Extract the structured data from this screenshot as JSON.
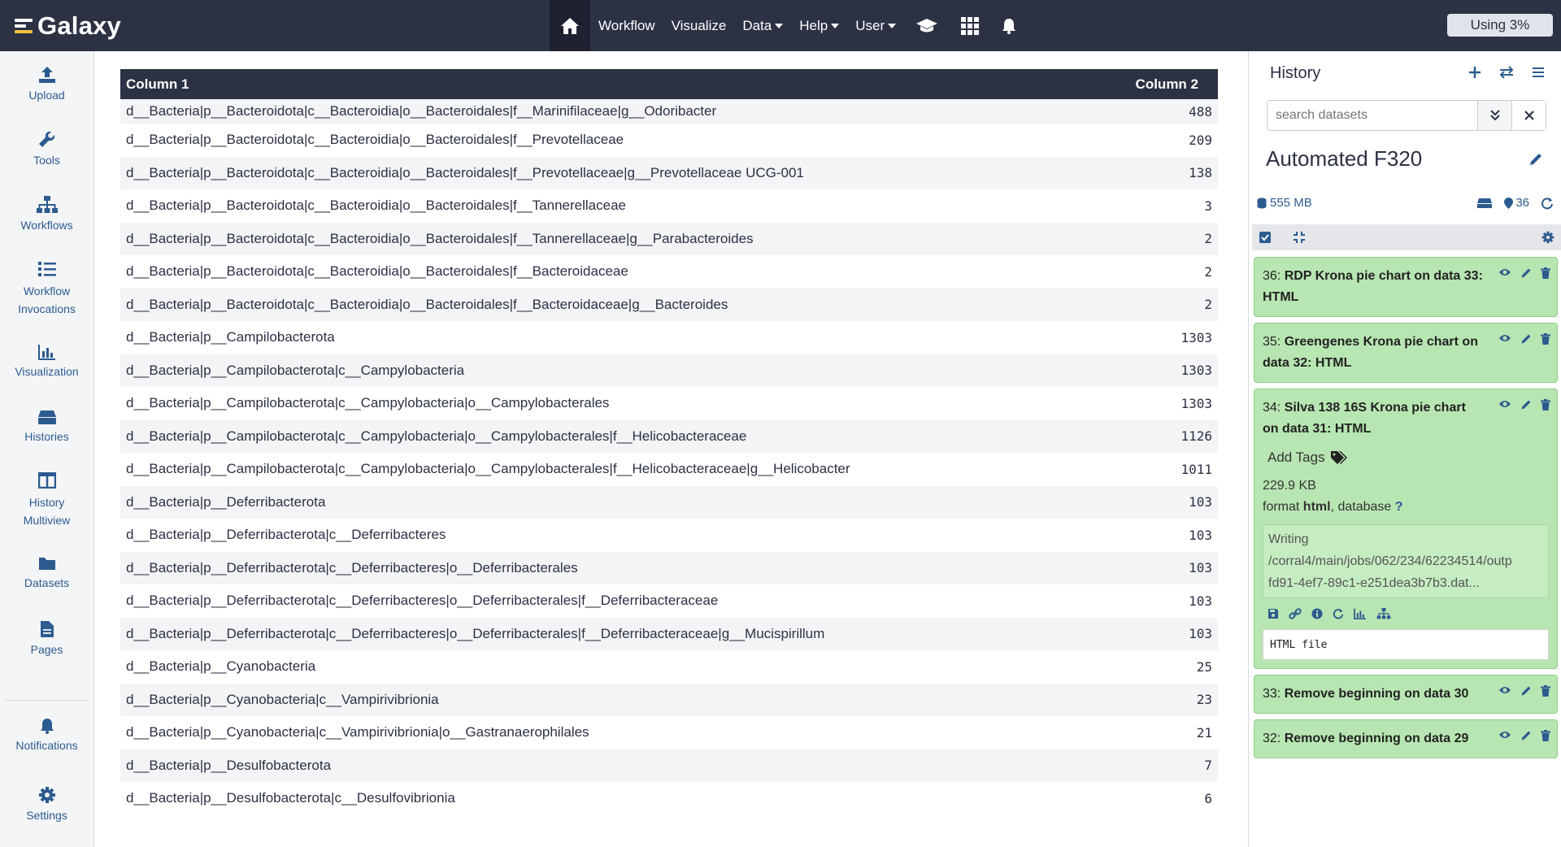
{
  "masthead": {
    "brand": "Galaxy",
    "nav": [
      "Workflow",
      "Visualize"
    ],
    "dropdowns": [
      "Data",
      "Help",
      "User"
    ],
    "quota": "Using 3%"
  },
  "activity": {
    "items": [
      {
        "label": "Upload",
        "icon": "upload-icon"
      },
      {
        "label": "Tools",
        "icon": "wrench-icon"
      },
      {
        "label": "Workflows",
        "icon": "sitemap-icon"
      },
      {
        "label": "Workflow Invocations",
        "icon": "list-icon"
      },
      {
        "label": "Visualization",
        "icon": "chart-icon"
      },
      {
        "label": "Histories",
        "icon": "hdd-icon"
      },
      {
        "label": "History Multiview",
        "icon": "columns-icon"
      },
      {
        "label": "Datasets",
        "icon": "folder-icon"
      },
      {
        "label": "Pages",
        "icon": "file-icon"
      },
      {
        "label": "Notifications",
        "icon": "bell-icon"
      },
      {
        "label": "Settings",
        "icon": "gear-icon"
      }
    ]
  },
  "table": {
    "headers": [
      "Column 1",
      "Column 2"
    ],
    "rows": [
      [
        "d__Bacteria|p__Bacteroidota|c__Bacteroidia|o__Bacteroidales|f__Marinifilaceae|g__Odoribacter",
        "488"
      ],
      [
        "d__Bacteria|p__Bacteroidota|c__Bacteroidia|o__Bacteroidales|f__Prevotellaceae",
        "209"
      ],
      [
        "d__Bacteria|p__Bacteroidota|c__Bacteroidia|o__Bacteroidales|f__Prevotellaceae|g__Prevotellaceae UCG-001",
        "138"
      ],
      [
        "d__Bacteria|p__Bacteroidota|c__Bacteroidia|o__Bacteroidales|f__Tannerellaceae",
        "3"
      ],
      [
        "d__Bacteria|p__Bacteroidota|c__Bacteroidia|o__Bacteroidales|f__Tannerellaceae|g__Parabacteroides",
        "2"
      ],
      [
        "d__Bacteria|p__Bacteroidota|c__Bacteroidia|o__Bacteroidales|f__Bacteroidaceae",
        "2"
      ],
      [
        "d__Bacteria|p__Bacteroidota|c__Bacteroidia|o__Bacteroidales|f__Bacteroidaceae|g__Bacteroides",
        "2"
      ],
      [
        "d__Bacteria|p__Campilobacterota",
        "1303"
      ],
      [
        "d__Bacteria|p__Campilobacterota|c__Campylobacteria",
        "1303"
      ],
      [
        "d__Bacteria|p__Campilobacterota|c__Campylobacteria|o__Campylobacterales",
        "1303"
      ],
      [
        "d__Bacteria|p__Campilobacterota|c__Campylobacteria|o__Campylobacterales|f__Helicobacteraceae",
        "1126"
      ],
      [
        "d__Bacteria|p__Campilobacterota|c__Campylobacteria|o__Campylobacterales|f__Helicobacteraceae|g__Helicobacter",
        "1011"
      ],
      [
        "d__Bacteria|p__Deferribacterota",
        "103"
      ],
      [
        "d__Bacteria|p__Deferribacterota|c__Deferribacteres",
        "103"
      ],
      [
        "d__Bacteria|p__Deferribacterota|c__Deferribacteres|o__Deferribacterales",
        "103"
      ],
      [
        "d__Bacteria|p__Deferribacterota|c__Deferribacteres|o__Deferribacterales|f__Deferribacteraceae",
        "103"
      ],
      [
        "d__Bacteria|p__Deferribacterota|c__Deferribacteres|o__Deferribacterales|f__Deferribacteraceae|g__Mucispirillum",
        "103"
      ],
      [
        "d__Bacteria|p__Cyanobacteria",
        "25"
      ],
      [
        "d__Bacteria|p__Cyanobacteria|c__Vampirivibrionia",
        "23"
      ],
      [
        "d__Bacteria|p__Cyanobacteria|c__Vampirivibrionia|o__Gastranaerophilales",
        "21"
      ],
      [
        "d__Bacteria|p__Desulfobacterota",
        "7"
      ],
      [
        "d__Bacteria|p__Desulfobacterota|c__Desulfovibrionia",
        "6"
      ]
    ]
  },
  "history": {
    "title": "History",
    "search_placeholder": "search datasets",
    "name": "Automated F320",
    "size": "555 MB",
    "count": "36",
    "items": [
      {
        "hid": "36: ",
        "name": "RDP Krona pie chart on data 33: HTML"
      },
      {
        "hid": "35: ",
        "name": "Greengenes Krona pie chart on data 32: HTML"
      },
      {
        "hid": "34: ",
        "name": "Silva 138 16S Krona pie chart on data 31: HTML"
      },
      {
        "hid": "33: ",
        "name": "Remove beginning on data 30"
      },
      {
        "hid": "32: ",
        "name": "Remove beginning on data 29"
      }
    ],
    "expanded": {
      "add_tags": "Add Tags",
      "size": "229.9 KB",
      "format_label": "format ",
      "format_value": "html",
      "database_label": ", database ",
      "database_value": "?",
      "info_line1": "Writing",
      "info_line2": "/corral4/main/jobs/062/234/62234514/outp",
      "info_line3": "fd91-4ef7-89c1-e251dea3b7b3.dat...",
      "preview": "HTML file"
    }
  }
}
